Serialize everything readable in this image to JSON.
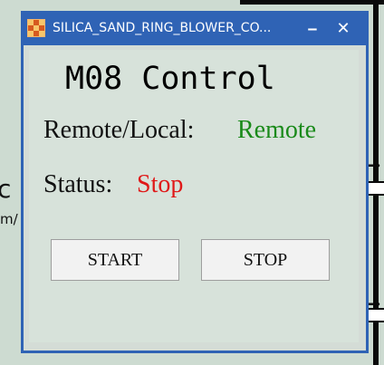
{
  "background": {
    "text_c": "c",
    "text_m": "m/"
  },
  "window": {
    "title": "SILICA_SAND_RING_BLOWER_CO...",
    "minimize_glyph": "‒",
    "close_glyph": "✕",
    "app_icon": "hmi-app-icon"
  },
  "panel": {
    "heading": "M08 Control",
    "remote_local_label": "Remote/Local:",
    "remote_local_value": "Remote",
    "status_label": "Status:",
    "status_value": "Stop",
    "start_label": "START",
    "stop_label": "STOP"
  },
  "colors": {
    "remote_value": "#1a8a1a",
    "status_value": "#e01818",
    "titlebar": "#2f63b5"
  }
}
